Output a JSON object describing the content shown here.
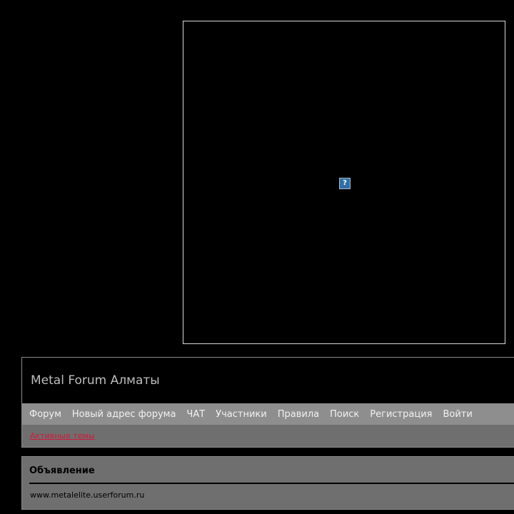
{
  "banner": {
    "image_icon": "broken-image-icon",
    "image_glyph": "?"
  },
  "header": {
    "title": "Metal Forum Алматы"
  },
  "nav": {
    "items": [
      {
        "label": "Форум"
      },
      {
        "label": "Новый адрес форума"
      },
      {
        "label": "ЧАТ"
      },
      {
        "label": "Участники"
      },
      {
        "label": "Правила"
      },
      {
        "label": "Поиск"
      },
      {
        "label": "Регистрация"
      },
      {
        "label": "Войти"
      }
    ]
  },
  "subnav": {
    "active_topics": "Активные темы"
  },
  "announcement": {
    "title": "Объявление",
    "text": "www.metalelite.userforum.ru"
  },
  "colors": {
    "background": "#000000",
    "navbar": "#8e8e8e",
    "panel": "#6f6f6f",
    "link_accent": "#d11a3c",
    "border": "#d9d9d9"
  }
}
